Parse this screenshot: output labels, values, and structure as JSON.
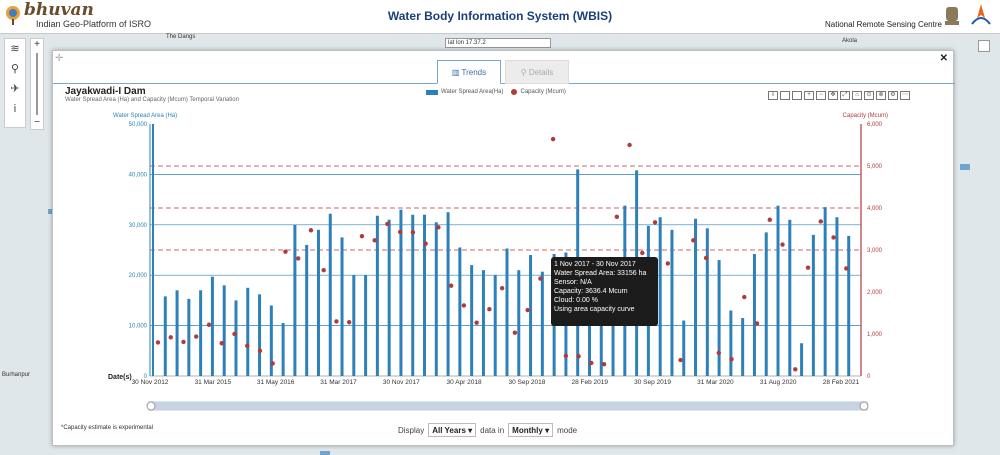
{
  "header": {
    "brand": "bhuvan",
    "brand_sub": "Indian Geo-Platform of ISRO",
    "title": "Water Body Information System (WBIS)",
    "org": "National Remote Sensing Centre"
  },
  "map": {
    "coords_text": "lat lon 17.37.2",
    "labels": [
      "The Dangs",
      "Akola",
      "Burhanpur"
    ]
  },
  "modal": {
    "tabs": {
      "trends": "Trends",
      "details": "Details"
    },
    "title": "Jayakwadi-I Dam",
    "subtitle": "Water Spread Area (Ha) and Capacity (Mcum) Temporal Variation",
    "legend_area": "Water Spread Area(Ha)",
    "legend_capacity": "Capacity (Mcum)",
    "footnote": "Capacity estimate is experimental",
    "display_label": "Display",
    "display_value": "All Years",
    "data_in_label": "data in",
    "mode_value": "Monthly",
    "mode_label": "mode",
    "tooltip": {
      "date": "1 Nov 2017 - 30 Nov 2017",
      "area": "Water Spread Area: 33156 ha",
      "sensor": "Sensor: N/A",
      "capacity": "Capacity: 3636.4 Mcum",
      "cloud": "Cloud: 0.00 %",
      "method": "Using area capacity curve"
    }
  },
  "chart_data": {
    "type": "bar",
    "title": "Jayakwadi-I Dam",
    "subtitle": "Water Spread Area (Ha) and Capacity (Mcum) Temporal Variation",
    "xlabel": "Date(s)",
    "ylabel": "Water Spread Area (Ha)",
    "y2label": "Capacity (Mcum)",
    "ylim": [
      0,
      50000
    ],
    "y2lim": [
      0,
      6000
    ],
    "yticks": [
      "0",
      "10,000",
      "20,000",
      "30,000",
      "40,000",
      "50,000"
    ],
    "y2ticks": [
      "0",
      "1,000",
      "2,000",
      "3,000",
      "4,000",
      "5,000",
      "6,000"
    ],
    "xticks": [
      "30 Nov 2012",
      "31 Mar 2015",
      "31 May 2016",
      "31 Mar 2017",
      "30 Nov 2017",
      "30 Apr 2018",
      "30 Sep 2018",
      "28 Feb 2019",
      "30 Sep 2019",
      "31 Mar 2020",
      "31 Aug 2020",
      "28 Feb 2021"
    ],
    "area_color": "#2d81b8",
    "capacity_color": "#b33a3a",
    "reference_lines_capacity": [
      3000,
      4000,
      5000
    ],
    "reference_lines_area": [
      10000,
      20000,
      30000,
      40000
    ],
    "series": [
      {
        "name": "Water Spread Area(Ha)",
        "values": [
          50000,
          15800,
          17000,
          15300,
          17000,
          19700,
          18000,
          15000,
          17500,
          16200,
          14000,
          10500,
          30000,
          26000,
          29000,
          32200,
          27500,
          20000,
          20000,
          31800,
          31000,
          33000,
          32000,
          32000,
          30500,
          32500,
          25500,
          22000,
          21000,
          20000,
          25300,
          21000,
          24000,
          20700,
          24200,
          24500,
          41000,
          23000,
          22000,
          22000,
          33800,
          40800,
          29800,
          31500,
          29000,
          11000,
          31200,
          29300,
          23000,
          13000,
          11500,
          24200,
          28500,
          33800,
          31000,
          6500,
          28000,
          33500,
          31500,
          27800
        ]
      },
      {
        "name": "Capacity (Mcum)",
        "values": [
          800,
          920,
          810,
          940,
          1220,
          780,
          1000,
          720,
          600,
          300,
          2960,
          2800,
          3470,
          2520,
          1300,
          1280,
          3330,
          3230,
          3620,
          3430,
          3420,
          3150,
          3540,
          2150,
          1680,
          1270,
          1590,
          2090,
          1030,
          1570,
          2320,
          5640,
          480,
          470,
          310,
          280,
          3790,
          5500,
          2930,
          3660,
          2680,
          380,
          3230,
          2810,
          550,
          400,
          1880,
          1250,
          3720,
          3130,
          160,
          2580,
          3680,
          3300,
          2560
        ]
      }
    ]
  }
}
